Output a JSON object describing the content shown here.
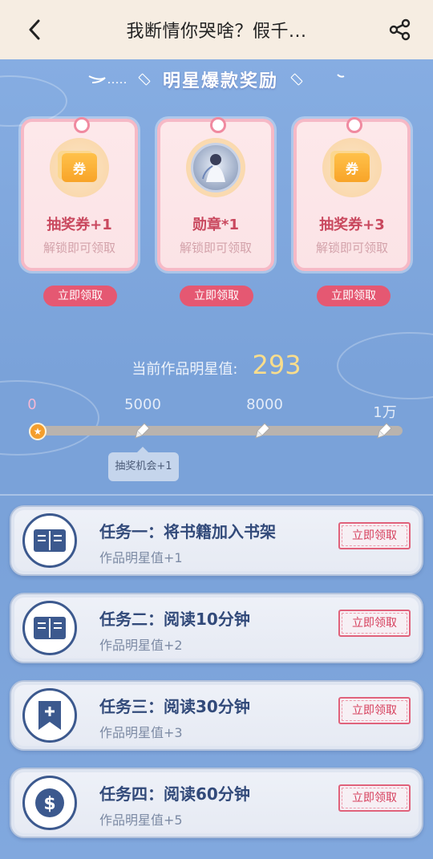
{
  "header": {
    "title": "我断情你哭啥？假千..."
  },
  "section": {
    "heading": "明星爆款奖励"
  },
  "rewards": [
    {
      "icon": "coupon-icon",
      "name": "抽奖券+1",
      "status": "解锁即可领取",
      "button": "立即领取"
    },
    {
      "icon": "medal-icon",
      "name": "勋章*1",
      "status": "解锁即可领取",
      "button": "立即领取"
    },
    {
      "icon": "coupon-icon",
      "name": "抽奖券+3",
      "status": "解锁即可领取",
      "button": "立即领取"
    }
  ],
  "progress": {
    "label": "当前作品明星值:",
    "value": "293",
    "milestones": [
      "0",
      "5000",
      "8000",
      "1万"
    ],
    "current": 293,
    "max": 10000,
    "tooltip": "抽奖机会+1"
  },
  "tasks": [
    {
      "icon": "book-icon",
      "title": "任务一：将书籍加入书架",
      "reward": "作品明星值+1",
      "button": "立即领取"
    },
    {
      "icon": "book-icon",
      "title": "任务二：阅读10分钟",
      "reward": "作品明星值+2",
      "button": "立即领取"
    },
    {
      "icon": "bookmark-plus-icon",
      "title": "任务三：阅读30分钟",
      "reward": "作品明星值+3",
      "button": "立即领取"
    },
    {
      "icon": "dollar-icon",
      "title": "任务四：阅读60分钟",
      "reward": "作品明星值+5",
      "button": "立即领取"
    }
  ],
  "colors": {
    "accent": "#e55872",
    "header_bg": "#f6ede2",
    "page_bg": "#7da6dc",
    "value": "#f9dd8c",
    "task_text": "#324a7a"
  }
}
